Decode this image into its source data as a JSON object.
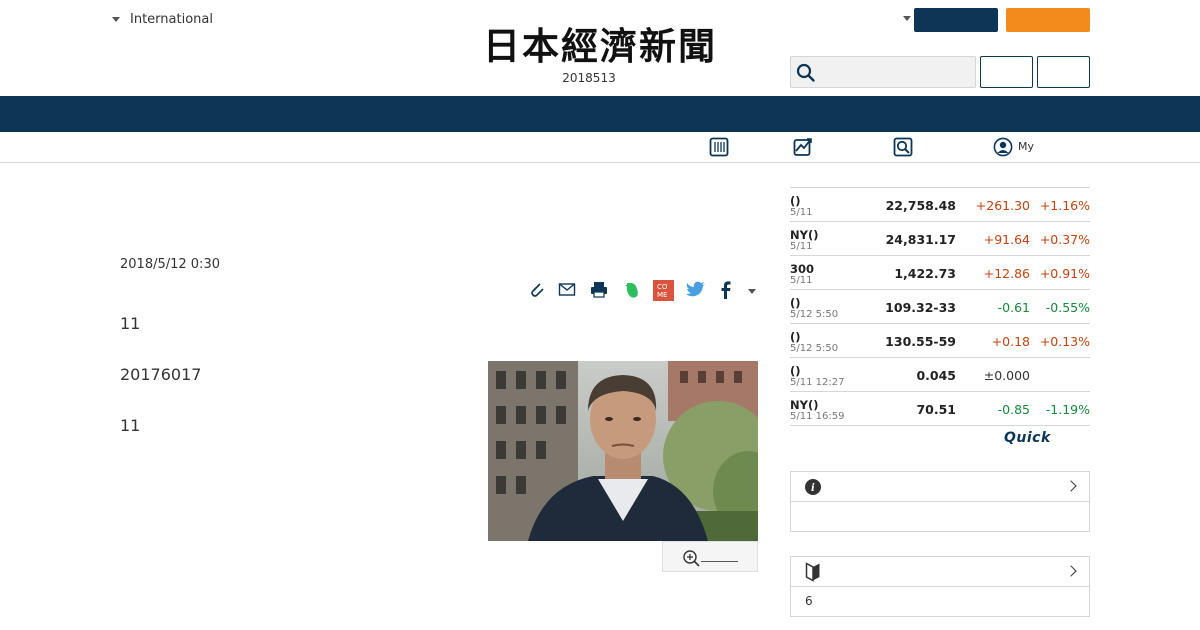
{
  "header": {
    "edition_label": "International",
    "logo_text": "日本經濟新聞",
    "date_text": "2018513"
  },
  "subnav": {
    "my_label": "My"
  },
  "article": {
    "datetime": "2018/5/12 0:30",
    "paragraphs": [
      "11",
      "20176017",
      "11"
    ]
  },
  "market": {
    "rows": [
      {
        "name": "()",
        "date": "5/11",
        "value": "22,758.48",
        "change": "+261.30",
        "percent": "+1.16%",
        "direction": "up"
      },
      {
        "name": "NY()",
        "date": "5/11",
        "value": "24,831.17",
        "change": "+91.64",
        "percent": "+0.37%",
        "direction": "up"
      },
      {
        "name": "300",
        "date": "5/11",
        "value": "1,422.73",
        "change": "+12.86",
        "percent": "+0.91%",
        "direction": "up"
      },
      {
        "name": "()",
        "date": "5/12 5:50",
        "value": "109.32-33",
        "change": "-0.61",
        "percent": "-0.55%",
        "direction": "down"
      },
      {
        "name": "()",
        "date": "5/12 5:50",
        "value": "130.55-59",
        "change": "+0.18",
        "percent": "+0.13%",
        "direction": "up"
      },
      {
        "name": "()",
        "date": "5/11 12:27",
        "value": "0.045",
        "change": "±0.000",
        "percent": "",
        "direction": "flat"
      },
      {
        "name": "NY()",
        "date": "5/11 16:59",
        "value": "70.51",
        "change": "-0.85",
        "percent": "-1.19%",
        "direction": "down"
      }
    ],
    "quick_logo": "Quick"
  },
  "side_boxes": [
    {
      "icon": "info-icon",
      "body": ""
    },
    {
      "icon": "beginner-mark-icon",
      "body": "6"
    }
  ],
  "colors": {
    "navy": "#0d3656",
    "orange": "#f28a1c",
    "up": "#c4420e",
    "down": "#16893b"
  }
}
